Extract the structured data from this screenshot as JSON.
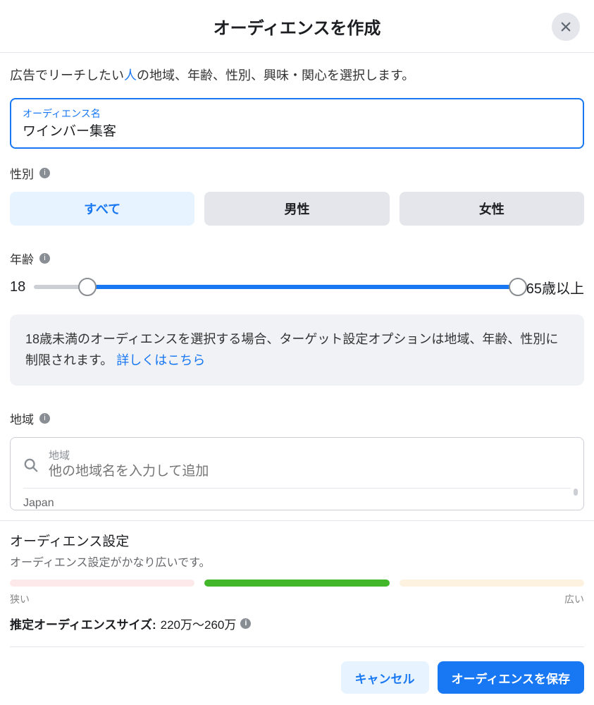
{
  "header": {
    "title": "オーディエンスを作成"
  },
  "intro": {
    "prefix": "広告でリーチしたい",
    "highlight": "人",
    "suffix": "の地域、年齢、性別、興味・関心を選択します。"
  },
  "name_field": {
    "label": "オーディエンス名",
    "value": "ワインバー集客"
  },
  "gender": {
    "label": "性別",
    "options": {
      "all": "すべて",
      "male": "男性",
      "female": "女性"
    }
  },
  "age": {
    "label": "年齢",
    "min": "18",
    "max": "65歳以上"
  },
  "notice": {
    "text": "18歳未満のオーディエンスを選択する場合、ターゲット設定オプションは地域、年齢、性別に制限されます。",
    "link": "詳しくはこちら"
  },
  "region": {
    "label": "地域",
    "field_label": "地域",
    "placeholder": "他の地域名を入力して追加",
    "items": [
      "Japan"
    ]
  },
  "audience": {
    "title": "オーディエンス設定",
    "status": "オーディエンス設定がかなり広いです。",
    "narrow_label": "狭い",
    "broad_label": "広い",
    "size_label": "推定オーディエンスサイズ:",
    "size_value": "220万〜260万"
  },
  "actions": {
    "cancel": "キャンセル",
    "save": "オーディエンスを保存"
  }
}
